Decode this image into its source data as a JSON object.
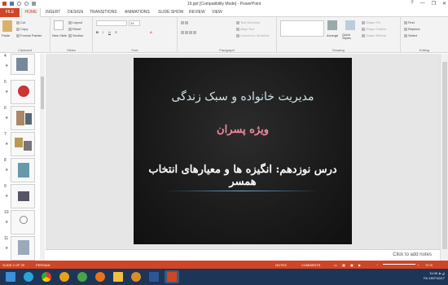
{
  "window": {
    "title": "19.ppt [Compatibility Mode] - PowerPoint",
    "controls": [
      "?",
      "—",
      "❐",
      "✕"
    ]
  },
  "tabs": {
    "file": "FILE",
    "home": "HOME",
    "others": [
      "INSERT",
      "DESIGN",
      "TRANSITIONS",
      "ANIMATIONS",
      "SLIDE SHOW",
      "REVIEW",
      "VIEW"
    ]
  },
  "ribbon": {
    "clipboard": {
      "label": "Clipboard",
      "paste": "Paste",
      "cut": "Cut",
      "copy": "Copy",
      "format_painter": "Format Painter"
    },
    "slides": {
      "label": "Slides",
      "new_slide": "New Slide",
      "layout": "Layout",
      "reset": "Reset",
      "section": "Section"
    },
    "font": {
      "label": "Font",
      "size": "24"
    },
    "paragraph": {
      "label": "Paragraph",
      "text_direction": "Text Direction",
      "align_text": "Align Text",
      "convert_smartart": "Convert to SmartArt"
    },
    "drawing": {
      "label": "Drawing",
      "arrange": "Arrange",
      "quick_styles": "Quick Styles",
      "shape_fill": "Shape Fill",
      "shape_outline": "Shape Outline",
      "shape_effects": "Shape Effects"
    },
    "editing": {
      "label": "Editing",
      "find": "Find",
      "replace": "Replace",
      "select": "Select"
    }
  },
  "thumbnails": [
    {
      "num": "4",
      "starred": true
    },
    {
      "num": "5",
      "starred": true
    },
    {
      "num": "6",
      "starred": true
    },
    {
      "num": "7",
      "starred": true
    },
    {
      "num": "8",
      "starred": true
    },
    {
      "num": "9",
      "starred": true
    },
    {
      "num": "10",
      "starred": true
    },
    {
      "num": "11",
      "starred": true
    }
  ],
  "slide": {
    "title": "مدیریت خانواده و سبک زندگی",
    "subtitle": "ویژه پسران",
    "lesson": "درس نوزدهم: انگیزه ها و معیارهای انتخاب همسر"
  },
  "notes_placeholder": "Click to add notes",
  "status": {
    "slide_info": "SLIDE 2 OF 25",
    "language": "PERSIAN",
    "notes": "NOTES",
    "comments": "COMMENTS",
    "zoom": "70 %"
  },
  "taskbar": {
    "lang": "FA",
    "time": "11:09 ق.ظ",
    "date": "1397/10/17"
  },
  "colors": {
    "accent": "#d04525",
    "taskbar": "#1d3557"
  }
}
